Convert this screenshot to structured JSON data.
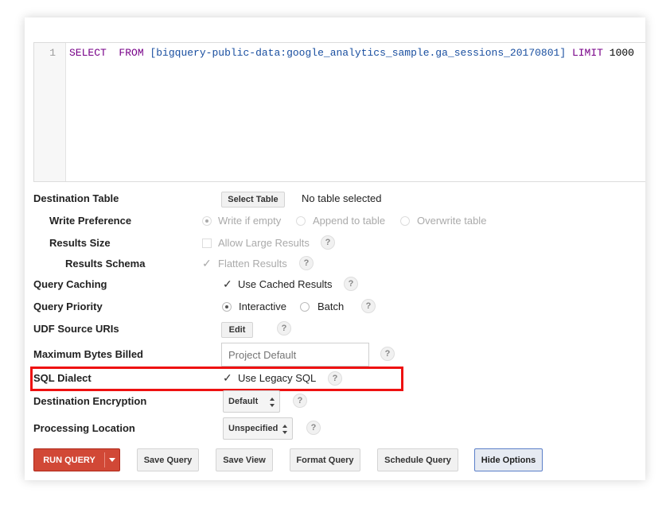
{
  "editor": {
    "line_number": "1",
    "keyword_select": "SELECT",
    "keyword_from": "FROM",
    "table_ref": "[bigquery-public-data:google_analytics_sample.ga_sessions_20170801]",
    "keyword_limit": "LIMIT",
    "limit_value": "1000"
  },
  "options": {
    "destination_table": {
      "label": "Destination Table",
      "button": "Select Table",
      "value": "No table selected"
    },
    "write_preference": {
      "label": "Write Preference",
      "options": [
        "Write if empty",
        "Append to table",
        "Overwrite table"
      ],
      "selected": "Write if empty",
      "disabled": true
    },
    "results_size": {
      "label": "Results Size",
      "checkbox": "Allow Large Results",
      "checked": false,
      "disabled": true
    },
    "results_schema": {
      "label": "Results Schema",
      "checkbox": "Flatten Results",
      "checked": true,
      "disabled": true
    },
    "query_caching": {
      "label": "Query Caching",
      "checkbox": "Use Cached Results",
      "checked": true
    },
    "query_priority": {
      "label": "Query Priority",
      "options": [
        "Interactive",
        "Batch"
      ],
      "selected": "Interactive"
    },
    "udf_source_uris": {
      "label": "UDF Source URIs",
      "button": "Edit"
    },
    "maximum_bytes_billed": {
      "label": "Maximum Bytes Billed",
      "placeholder": "Project Default"
    },
    "sql_dialect": {
      "label": "SQL Dialect",
      "checkbox": "Use Legacy SQL",
      "checked": true
    },
    "destination_encryption": {
      "label": "Destination Encryption",
      "value": "Default"
    },
    "processing_location": {
      "label": "Processing Location",
      "value": "Unspecified"
    },
    "help_glyph": "?"
  },
  "actions": {
    "run_query": "RUN QUERY",
    "save_query": "Save Query",
    "save_view": "Save View",
    "format_query": "Format Query",
    "schedule_query": "Schedule Query",
    "hide_options": "Hide Options"
  },
  "colors": {
    "run_button": "#d14836",
    "highlight_box": "#ee1111",
    "keyword": "#770088",
    "table_ref": "#1a4fa0"
  }
}
